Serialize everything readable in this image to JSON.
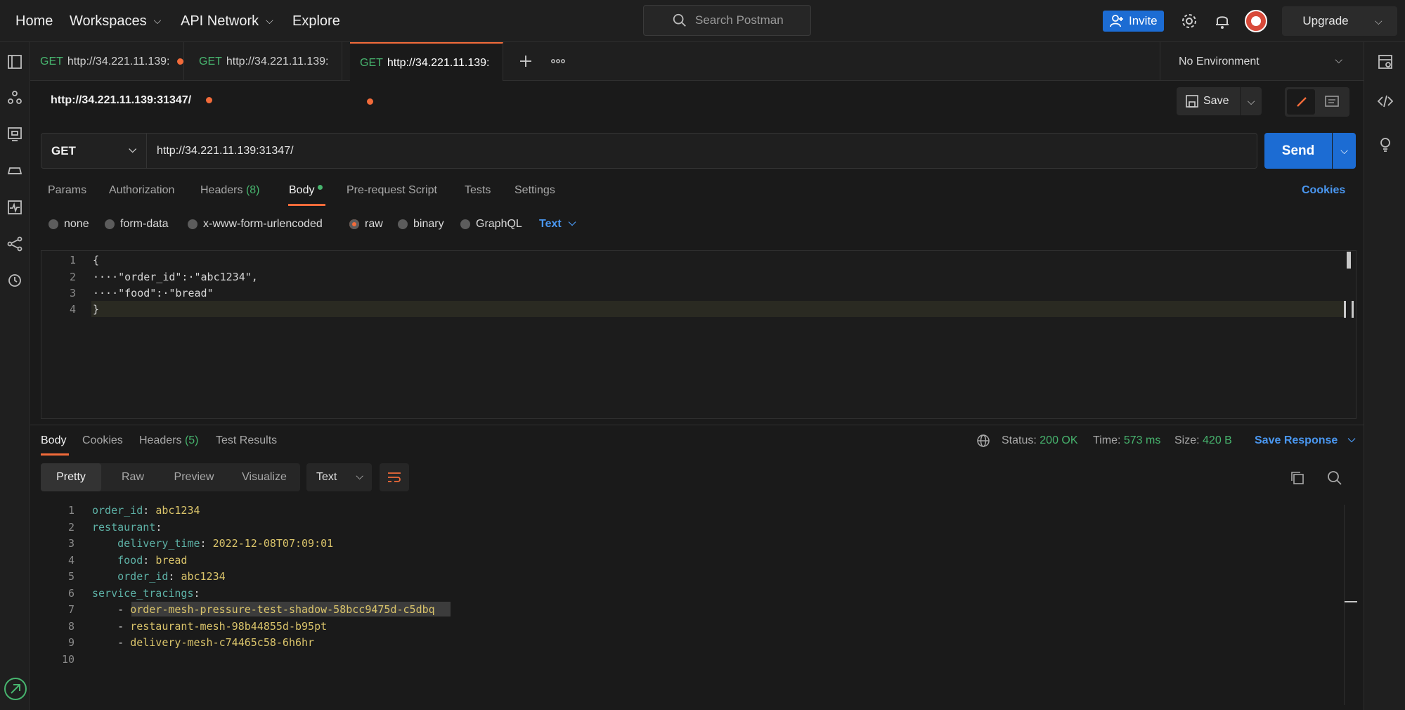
{
  "nav": {
    "home": "Home",
    "workspaces": "Workspaces",
    "api_network": "API Network",
    "explore": "Explore",
    "search_placeholder": "Search Postman",
    "invite": "Invite",
    "upgrade": "Upgrade"
  },
  "tabs": [
    {
      "method": "GET",
      "label": "http://34.221.11.139:"
    },
    {
      "method": "GET",
      "label": "http://34.221.11.139:"
    },
    {
      "method": "GET",
      "label": "http://34.221.11.139:"
    }
  ],
  "environment": "No Environment",
  "request": {
    "title": "http://34.221.11.139:31347/",
    "save": "Save",
    "method": "GET",
    "url": "http://34.221.11.139:31347/",
    "send": "Send"
  },
  "request_tabs": {
    "params": "Params",
    "authorization": "Authorization",
    "headers": "Headers",
    "headers_count": "(8)",
    "body": "Body",
    "prerequest": "Pre-request Script",
    "tests": "Tests",
    "settings": "Settings",
    "cookies": "Cookies"
  },
  "body_types": {
    "none": "none",
    "form_data": "form-data",
    "urlencoded": "x-www-form-urlencoded",
    "raw": "raw",
    "binary": "binary",
    "graphql": "GraphQL",
    "text": "Text"
  },
  "request_body": {
    "line_numbers": [
      "1",
      "2",
      "3",
      "4"
    ],
    "lines": [
      "{",
      "····\"order_id\":·\"abc1234\",",
      "····\"food\":·\"bread\"",
      "}"
    ]
  },
  "response_tabs": {
    "body": "Body",
    "cookies": "Cookies",
    "headers": "Headers",
    "headers_count": "(5)",
    "test_results": "Test Results"
  },
  "status": {
    "status_label": "Status:",
    "status_value": "200 OK",
    "time_label": "Time:",
    "time_value": "573 ms",
    "size_label": "Size:",
    "size_value": "420 B",
    "save_response": "Save Response"
  },
  "format": {
    "pretty": "Pretty",
    "raw": "Raw",
    "preview": "Preview",
    "visualize": "Visualize",
    "text": "Text"
  },
  "response_body": {
    "line_numbers": [
      "1",
      "2",
      "3",
      "4",
      "5",
      "6",
      "7",
      "8",
      "9",
      "10"
    ],
    "l1_key": "order_id",
    "l1_val": "abc1234",
    "l2_key": "restaurant",
    "l3_key": "delivery_time",
    "l3_val": "2022-12-08T07:09:01",
    "l4_key": "food",
    "l4_val": "bread",
    "l5_key": "order_id",
    "l5_val": "abc1234",
    "l6_key": "service_tracings",
    "l7_val": "order-mesh-pressure-test-shadow-58bcc9475d-c5dbq",
    "l8_val": "restaurant-mesh-98b44855d-b95pt",
    "l9_val": "delivery-mesh-c74465c58-6h6hr"
  },
  "colors": {
    "accent": "#f26b3a",
    "primary_blue": "#1c6cd3",
    "success_green": "#47b46e"
  }
}
